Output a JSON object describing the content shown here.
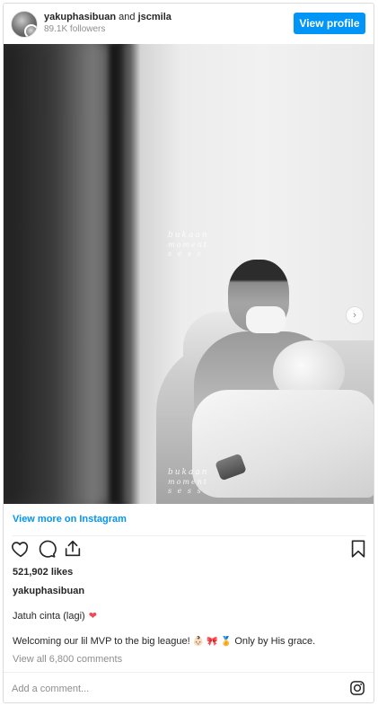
{
  "header": {
    "username_primary": "yakuphasibuan",
    "and_word": "and",
    "username_secondary": "jscmila",
    "followers": "89.1K followers",
    "view_profile_label": "View profile"
  },
  "photo": {
    "watermark_line1": "bukaan",
    "watermark_line2": "moment",
    "watermark_sub": "s e s s"
  },
  "view_more_label": "View more on Instagram",
  "icons": {
    "like": "heart-icon",
    "comment": "comment-icon",
    "share": "share-icon",
    "save": "bookmark-icon",
    "next": "chevron-right-icon",
    "instagram": "instagram-icon"
  },
  "likes": "521,902 likes",
  "caption_username": "yakuphasibuan",
  "caption": {
    "line1": "Jatuh cinta (lagi)",
    "line1_emoji": "❤",
    "line2_text_a": "Welcoming our lil MVP to the big league!",
    "line2_emoji_a": "👶🏻",
    "line2_emoji_b": "🎀",
    "line2_emoji_c": "🏅",
    "line2_text_b": "Only by His grace."
  },
  "view_all_comments": "View all 6,800 comments",
  "comment_placeholder": "Add a comment...",
  "colors": {
    "accent": "#0095f6",
    "heart_red": "#ed4956",
    "muted": "#8e8e8e"
  }
}
